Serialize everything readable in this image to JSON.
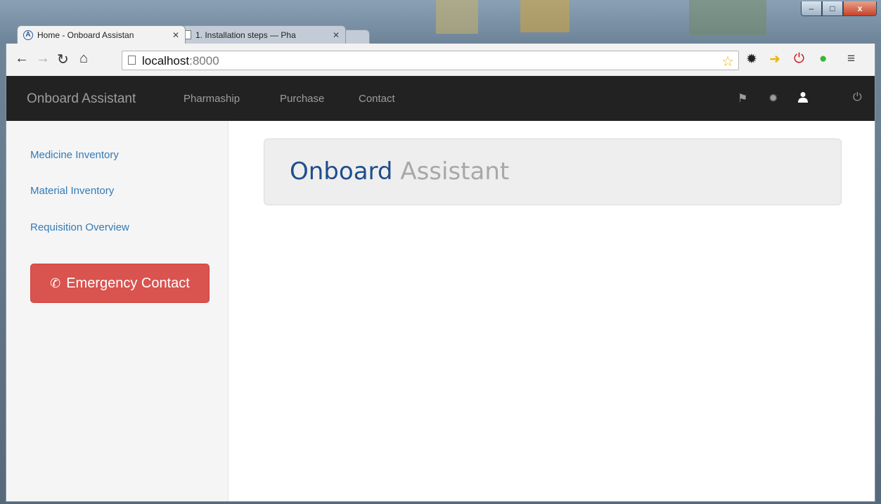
{
  "browser": {
    "tabs": [
      {
        "title": "Home - Onboard Assistan",
        "active": true,
        "favicon": "onboard-logo-icon"
      },
      {
        "title": "1. Installation steps — Pha",
        "active": false,
        "favicon": "page-icon"
      }
    ],
    "address": {
      "host": "localhost",
      "port": ":8000"
    },
    "window_controls": {
      "minimize": "–",
      "maximize": "□",
      "close": "x"
    }
  },
  "navbar": {
    "brand": "Onboard Assistant",
    "links": [
      "Pharmaship",
      "Purchase",
      "Contact"
    ],
    "icons": [
      "flag-icon",
      "gear-icon",
      "user-icon",
      "power-icon"
    ]
  },
  "sidebar": {
    "links": [
      "Medicine Inventory",
      "Material Inventory",
      "Requisition Overview"
    ],
    "emergency_button": "Emergency Contact"
  },
  "jumbotron": {
    "title_part1": "Onboard",
    "title_part2": "Assistant"
  },
  "colors": {
    "navbar_bg": "#222222",
    "link": "#337ab7",
    "danger": "#d9534f",
    "jumbotron_bg": "#eeeeee",
    "title_blue": "#1f4e8c"
  }
}
